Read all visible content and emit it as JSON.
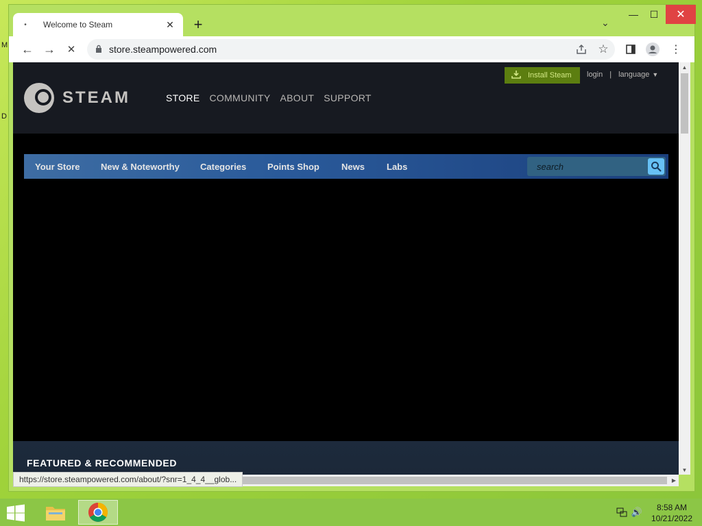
{
  "desktop": {
    "fragments": [
      "M",
      "D"
    ]
  },
  "browser": {
    "tab": {
      "title": "Welcome to Steam",
      "close": "✕"
    },
    "new_tab": "+",
    "tab_search": "⌄",
    "window_controls": {
      "minimize": "—",
      "maximize": "☐",
      "close": "✕"
    },
    "nav": {
      "back": "←",
      "forward": "→",
      "stop": "✕"
    },
    "url": "store.steampowered.com",
    "status_url": "https://store.steampowered.com/about/?snr=1_4_4__glob..."
  },
  "steam": {
    "logo_text": "STEAM",
    "main_nav": [
      "STORE",
      "COMMUNITY",
      "ABOUT",
      "SUPPORT"
    ],
    "install_label": "Install Steam",
    "login": "login",
    "separator": "|",
    "language": "language",
    "store_nav": [
      "Your Store",
      "New & Noteworthy",
      "Categories",
      "Points Shop",
      "News",
      "Labs"
    ],
    "search_placeholder": "search",
    "featured_title": "FEATURED & RECOMMENDED"
  },
  "taskbar": {
    "time": "8:58 AM",
    "date": "10/21/2022"
  },
  "colors": {
    "steam_header": "#171a21",
    "install_green": "#5c7e10",
    "storenav_blue": "#2a5a9a",
    "search_button": "#67c1f5",
    "window_close": "#e04343"
  }
}
